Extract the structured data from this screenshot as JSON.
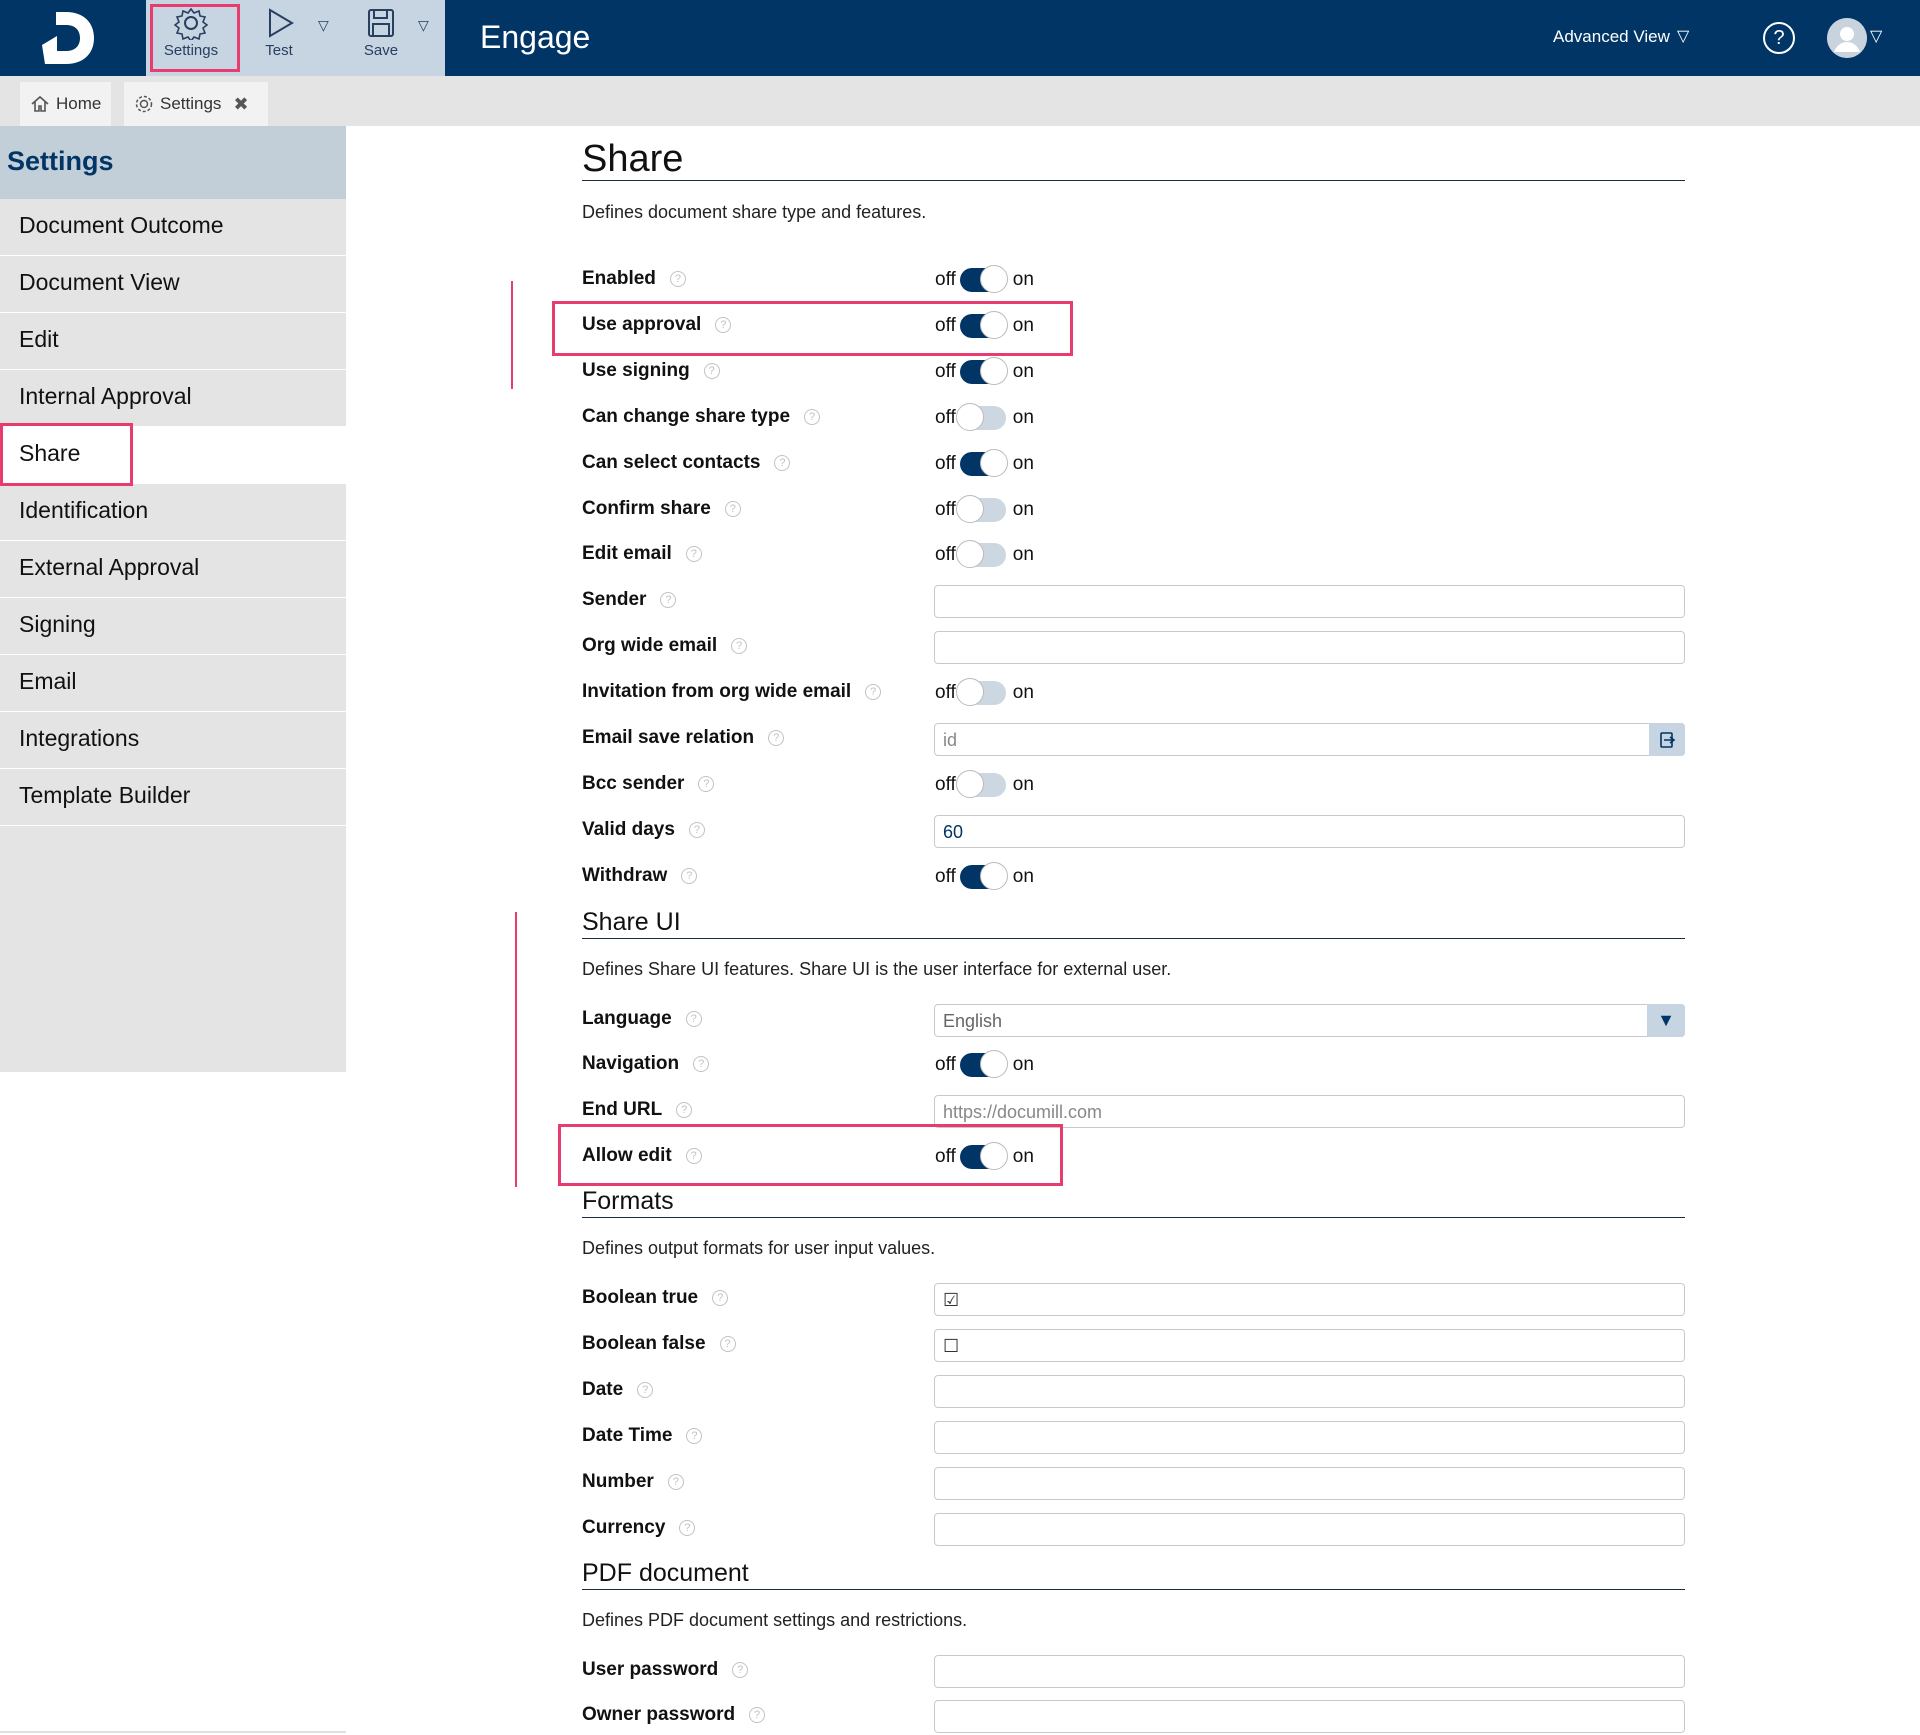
{
  "header": {
    "app_title": "Engage",
    "toolbar": {
      "settings_label": "Settings",
      "test_label": "Test",
      "save_label": "Save"
    },
    "advanced_view_label": "Advanced View",
    "help_glyph": "?",
    "dropdown_glyph": "▽",
    "icons": {
      "logo": "documill-logo",
      "settings": "gear-icon",
      "test": "play-icon",
      "save": "floppy-disk-icon",
      "help": "help-icon",
      "avatar": "user-avatar-icon"
    },
    "colors": {
      "header_bg": "#003566",
      "toolbar_bg": "#c7d5e2",
      "highlight": "#e83c6f"
    }
  },
  "tabs": [
    {
      "label": "Home",
      "icon": "home-icon"
    },
    {
      "label": "Settings",
      "icon": "gear-icon",
      "close_glyph": "✖"
    }
  ],
  "sidebar": {
    "title": "Settings",
    "items": [
      {
        "label": "Document Outcome"
      },
      {
        "label": "Document View"
      },
      {
        "label": "Edit"
      },
      {
        "label": "Internal Approval"
      },
      {
        "label": "Share",
        "active": true
      },
      {
        "label": "Identification"
      },
      {
        "label": "External Approval"
      },
      {
        "label": "Signing"
      },
      {
        "label": "Email"
      },
      {
        "label": "Integrations"
      },
      {
        "label": "Template Builder"
      }
    ]
  },
  "toggle_text": {
    "off": "off",
    "on": "on"
  },
  "help_mark": "?",
  "share": {
    "title": "Share",
    "description": "Defines document share type and features.",
    "fields": [
      {
        "label": "Enabled",
        "type": "toggle",
        "value": true
      },
      {
        "label": "Use approval",
        "type": "toggle",
        "value": true
      },
      {
        "label": "Use signing",
        "type": "toggle",
        "value": true
      },
      {
        "label": "Can change share type",
        "type": "toggle",
        "value": false
      },
      {
        "label": "Can select contacts",
        "type": "toggle",
        "value": true
      },
      {
        "label": "Confirm share",
        "type": "toggle",
        "value": false
      },
      {
        "label": "Edit email",
        "type": "toggle",
        "value": false
      },
      {
        "label": "Sender",
        "type": "text",
        "value": ""
      },
      {
        "label": "Org wide email",
        "type": "text",
        "value": ""
      },
      {
        "label": "Invitation from org wide email",
        "type": "toggle",
        "value": false
      },
      {
        "label": "Email save relation",
        "type": "text",
        "value": "",
        "placeholder": "id"
      },
      {
        "label": "Bcc sender",
        "type": "toggle",
        "value": false
      },
      {
        "label": "Valid days",
        "type": "text",
        "value": "60"
      },
      {
        "label": "Withdraw",
        "type": "toggle",
        "value": true
      }
    ]
  },
  "share_ui": {
    "title": "Share UI",
    "description": "Defines Share UI features. Share UI is the user interface for external user.",
    "fields": [
      {
        "label": "Language",
        "type": "select",
        "value": "English"
      },
      {
        "label": "Navigation",
        "type": "toggle",
        "value": true
      },
      {
        "label": "End URL",
        "type": "text",
        "value": "",
        "placeholder": "https://documill.com"
      },
      {
        "label": "Allow edit",
        "type": "toggle",
        "value": true
      }
    ]
  },
  "formats": {
    "title": "Formats",
    "description": "Defines output formats for user input values.",
    "fields": [
      {
        "label": "Boolean true",
        "type": "text",
        "value": "☑"
      },
      {
        "label": "Boolean false",
        "type": "text",
        "value": "☐"
      },
      {
        "label": "Date",
        "type": "text",
        "value": ""
      },
      {
        "label": "Date Time",
        "type": "text",
        "value": ""
      },
      {
        "label": "Number",
        "type": "text",
        "value": ""
      },
      {
        "label": "Currency",
        "type": "text",
        "value": ""
      }
    ]
  },
  "pdf": {
    "title": "PDF document",
    "description": "Defines PDF document settings and restrictions.",
    "fields": [
      {
        "label": "User password",
        "type": "text",
        "value": ""
      },
      {
        "label": "Owner password",
        "type": "text",
        "value": ""
      }
    ]
  }
}
